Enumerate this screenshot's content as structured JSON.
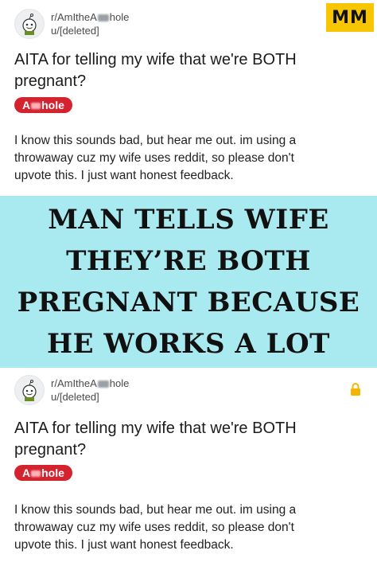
{
  "posts": [
    {
      "subreddit_prefix": "r/AmItheA",
      "subreddit_suffix": "hole",
      "user": "u/[deleted]",
      "title_line1": "AITA for telling my wife that we're BOTH",
      "title_line2": "pregnant?",
      "flair_prefix": "A",
      "flair_suffix": "hole",
      "body_line1": "I know this sounds bad, but hear me out. im using a",
      "body_line2": "throwaway cuz my wife uses reddit, so please don't",
      "body_line3": "upvote this. I just want honest feedback."
    },
    {
      "subreddit_prefix": "r/AmItheA",
      "subreddit_suffix": "hole",
      "user": "u/[deleted]",
      "title_line1": "AITA for telling my wife that we're BOTH",
      "title_line2": "pregnant?",
      "flair_prefix": "A",
      "flair_suffix": "hole",
      "body_line1": "I know this sounds bad, but hear me out. im using a",
      "body_line2": "throwaway cuz my wife uses reddit, so please don't",
      "body_line3": "upvote this. I just want honest feedback."
    }
  ],
  "logo_text": "MM",
  "banner": {
    "line1": "MAN TELLS WIFE",
    "line2": "THEY’RE BOTH",
    "line3": "PREGNANT BECAUSE",
    "line4": "HE WORKS A LOT"
  },
  "colors": {
    "banner_bg": "#a8eaef",
    "flair_bg": "#d3232f",
    "logo_bg": "#f7c600",
    "lock": "#f5b400"
  },
  "icons": {
    "avatar": "reddit-snoo-avatar-icon",
    "lock": "lock-icon"
  }
}
